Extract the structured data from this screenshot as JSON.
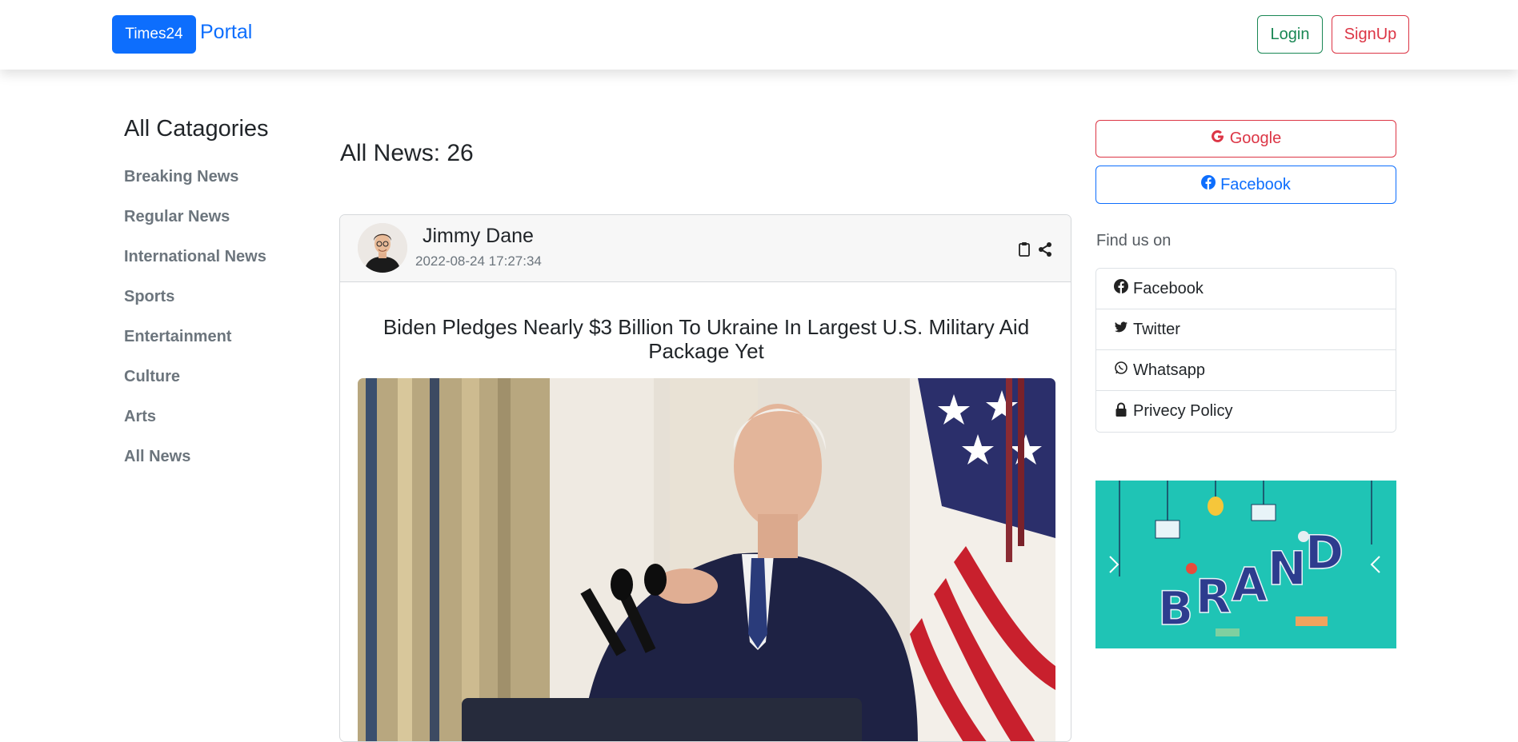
{
  "header": {
    "brand": "Times24",
    "portal": "Portal",
    "login": "Login",
    "signup": "SignUp"
  },
  "sidebar": {
    "title": "All Catagories",
    "items": [
      {
        "label": "Breaking News"
      },
      {
        "label": "Regular News"
      },
      {
        "label": "International News"
      },
      {
        "label": "Sports"
      },
      {
        "label": "Entertainment"
      },
      {
        "label": "Culture"
      },
      {
        "label": "Arts"
      },
      {
        "label": "All News"
      }
    ]
  },
  "main": {
    "news_count_label": "All News: 26",
    "card": {
      "author": "Jimmy Dane",
      "datetime": "2022-08-24 17:27:34",
      "title": "Biden Pledges Nearly $3 Billion To Ukraine In Largest U.S. Military Aid Package Yet",
      "icons": [
        "clipboard-icon",
        "share-icon"
      ]
    }
  },
  "right": {
    "google_label": "Google",
    "facebook_label": "Facebook",
    "find_us": "Find us on",
    "social": [
      {
        "label": "Facebook",
        "icon": "facebook-icon"
      },
      {
        "label": "Twitter",
        "icon": "twitter-icon"
      },
      {
        "label": "Whatsapp",
        "icon": "whatsapp-icon"
      },
      {
        "label": "Privecy Policy",
        "icon": "lock-icon"
      }
    ],
    "banner_text": "BRAND"
  },
  "colors": {
    "primary": "#0d6efd",
    "success": "#198754",
    "danger": "#dc3545",
    "muted": "#6c757d",
    "banner_bg": "#1fc4b5"
  }
}
